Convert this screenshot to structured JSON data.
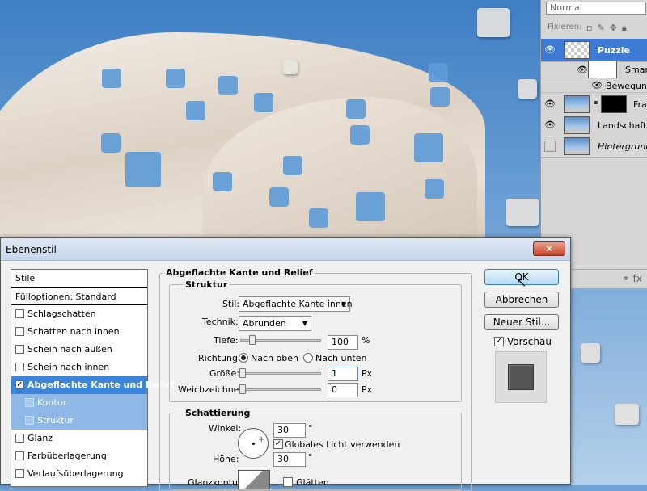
{
  "layers_panel": {
    "blend_mode": "Normal",
    "fix_label": "Fixieren:",
    "layers": [
      {
        "name": "Puzzle",
        "selected": true,
        "visible": true
      },
      {
        "name": "Smartfi",
        "sub": true
      },
      {
        "name": "Bewegungs",
        "sub": true
      },
      {
        "name": "Fra",
        "visible": true
      },
      {
        "name": "Landschaft oh",
        "visible": true
      },
      {
        "name": "Hintergrund",
        "visible": false
      }
    ],
    "bottom_icons": "⚭ fx"
  },
  "dialog": {
    "title": "Ebenenstil",
    "close_label": "✕",
    "styles_header": "Stile",
    "fill_options": "Fülloptionen: Standard",
    "styles": [
      {
        "label": "Schlagschatten",
        "checked": false
      },
      {
        "label": "Schatten nach innen",
        "checked": false
      },
      {
        "label": "Schein nach außen",
        "checked": false
      },
      {
        "label": "Schein nach innen",
        "checked": false
      },
      {
        "label": "Abgeflachte Kante und Relief",
        "checked": true,
        "selected": true
      },
      {
        "label": "Kontur",
        "checked": false,
        "sub": true
      },
      {
        "label": "Struktur",
        "checked": false,
        "sub": true
      },
      {
        "label": "Glanz",
        "checked": false
      },
      {
        "label": "Farbüberlagerung",
        "checked": false
      },
      {
        "label": "Verlaufsüberlagerung",
        "checked": false
      }
    ],
    "section_title": "Abgeflachte Kante und Relief",
    "structure": {
      "legend": "Struktur",
      "style_label": "Stil:",
      "style_value": "Abgeflachte Kante innen",
      "technique_label": "Technik:",
      "technique_value": "Abrunden",
      "depth_label": "Tiefe:",
      "depth_value": "100",
      "depth_unit": "%",
      "direction_label": "Richtung:",
      "direction_up": "Nach oben",
      "direction_down": "Nach unten",
      "size_label": "Größe:",
      "size_value": "1",
      "size_unit": "Px",
      "soften_label": "Weichzeichnen:",
      "soften_value": "0",
      "soften_unit": "Px"
    },
    "shading": {
      "legend": "Schattierung",
      "angle_label": "Winkel:",
      "angle_value": "30",
      "angle_unit": "°",
      "global_light_label": "Globales Licht verwenden",
      "global_light_checked": true,
      "altitude_label": "Höhe:",
      "altitude_value": "30",
      "altitude_unit": "°",
      "gloss_label": "Glanzkontur:",
      "antialias_label": "Glätten"
    },
    "buttons": {
      "ok": "OK",
      "cancel": "Abbrechen",
      "new_style": "Neuer Stil...",
      "preview_label": "Vorschau",
      "preview_checked": true
    }
  }
}
